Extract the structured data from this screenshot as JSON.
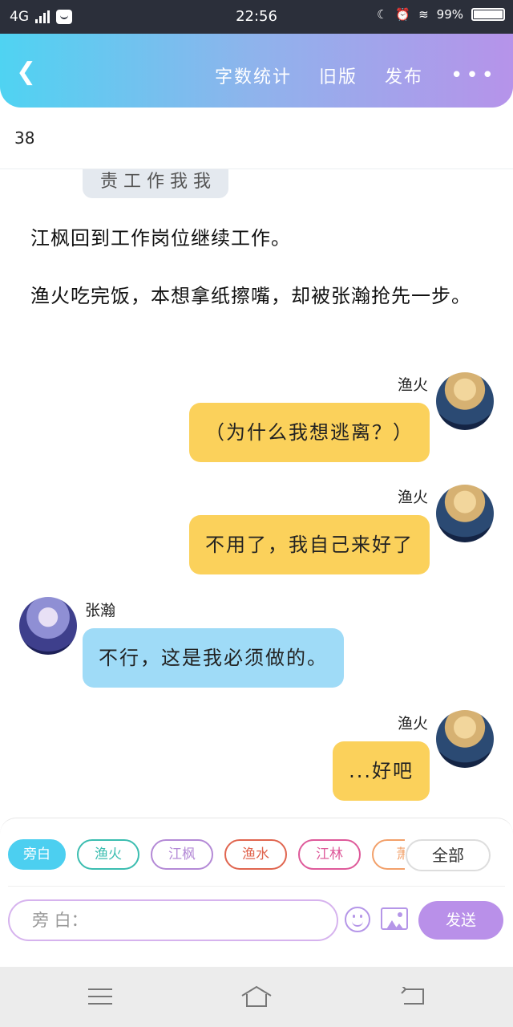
{
  "status_bar": {
    "network": "4G",
    "time": "22:56",
    "battery_text": "99%",
    "battery_level": 0.99
  },
  "header": {
    "back_icon": "chevron-left-icon",
    "word_count_label": "字数统计",
    "old_version_label": "旧版",
    "publish_label": "发布",
    "more_label": "•••"
  },
  "word_count": "38",
  "chat": {
    "partial_bubble_text": "责 工 作 我 我",
    "narrations": [
      "江枫回到工作岗位继续工作。",
      "渔火吃完饭，本想拿纸擦嘴，却被张瀚抢先一步。"
    ],
    "messages": [
      {
        "speaker": "渔火",
        "text": "（为什么我想逃离？）",
        "side": "right"
      },
      {
        "speaker": "渔火",
        "text": "不用了，我自己来好了",
        "side": "right"
      },
      {
        "speaker": "张瀚",
        "text": "不行，这是我必须做的。",
        "side": "left"
      },
      {
        "speaker": "渔火",
        "text": "...好吧",
        "side": "right"
      }
    ]
  },
  "composer": {
    "character_tags": [
      {
        "label": "旁白",
        "color": "#4ccff0",
        "selected": true
      },
      {
        "label": "渔火",
        "color": "#3bbdb0",
        "selected": false
      },
      {
        "label": "江枫",
        "color": "#b48ad6",
        "selected": false
      },
      {
        "label": "渔水",
        "color": "#e0654f",
        "selected": false
      },
      {
        "label": "江林",
        "color": "#de5a9a",
        "selected": false
      },
      {
        "label": "萧",
        "color": "#f2a06a",
        "selected": false
      }
    ],
    "all_label": "全部",
    "input_placeholder": "旁 白：",
    "send_label": "发送"
  },
  "colors": {
    "header_gradient": [
      "#4fd3f2",
      "#b693ea"
    ],
    "bubble_right": "#fbd15b",
    "bubble_left": "#9fdbf7",
    "accent": "#b990e9"
  }
}
